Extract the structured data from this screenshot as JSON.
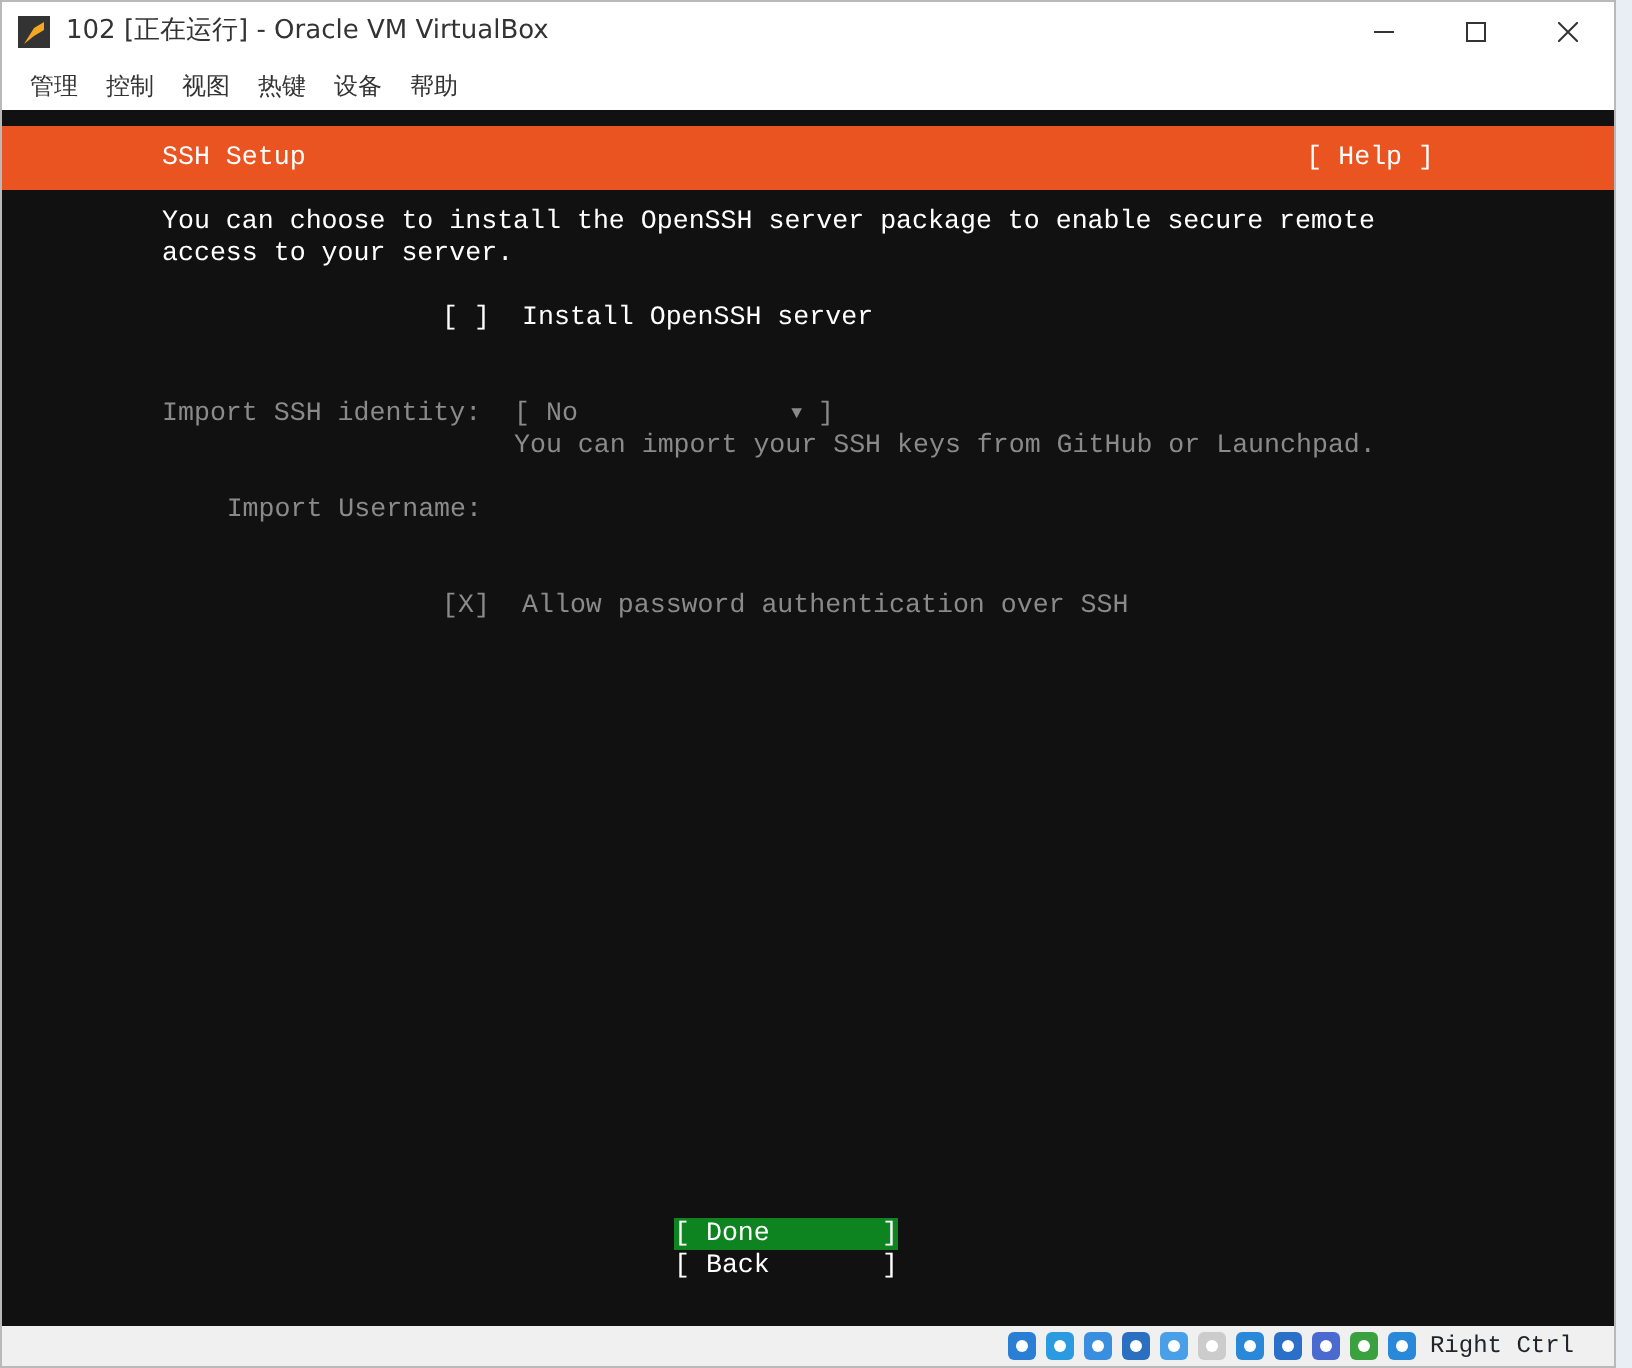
{
  "window": {
    "title": "102 [正在运行] - Oracle VM VirtualBox"
  },
  "menu": [
    "管理",
    "控制",
    "视图",
    "热键",
    "设备",
    "帮助"
  ],
  "header": {
    "title": "SSH Setup",
    "help": "[ Help ]"
  },
  "description": "You can choose to install the OpenSSH server package to enable secure remote access to your server.",
  "install_openssh": {
    "box": "[ ]",
    "label": "Install OpenSSH server",
    "disabled": false
  },
  "import_identity": {
    "label": "Import SSH identity:",
    "value": "[ No",
    "arrow": "▼",
    "close": "]",
    "hint": "You can import your SSH keys from GitHub or Launchpad.",
    "disabled": true
  },
  "import_username": {
    "label": "Import Username:",
    "disabled": true
  },
  "allow_password": {
    "box": "[X]",
    "label": "Allow password authentication over SSH",
    "disabled": true
  },
  "buttons": [
    {
      "open": "[",
      "label": "Done",
      "close": "]",
      "selected": true
    },
    {
      "open": "[",
      "label": "Back",
      "close": "]",
      "selected": false
    }
  ],
  "status_bar": {
    "host_key": "Right Ctrl"
  }
}
